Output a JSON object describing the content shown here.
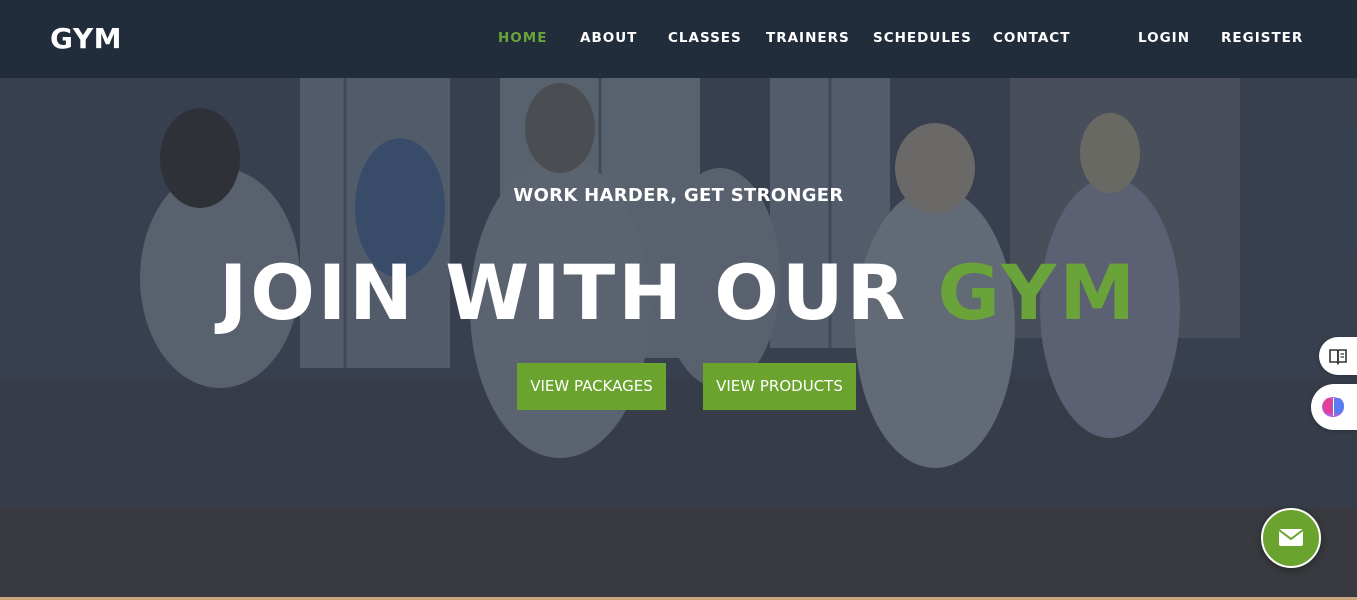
{
  "brand": {
    "logo": "GYM"
  },
  "nav": {
    "items": [
      {
        "label": "HOME",
        "active": true
      },
      {
        "label": "ABOUT"
      },
      {
        "label": "CLASSES"
      },
      {
        "label": "TRAINERS"
      },
      {
        "label": "SCHEDULES"
      },
      {
        "label": "CONTACT"
      }
    ],
    "login": "LOGIN",
    "register": "REGISTER"
  },
  "hero": {
    "subtitle": "WORK HARDER, GET STRONGER",
    "title_main": "JOIN WITH OUR ",
    "title_accent": "GYM",
    "buttons": {
      "packages": "VIEW PACKAGES",
      "products": "VIEW PRODUCTS"
    }
  },
  "widgets": {
    "reader": "book-reader-icon",
    "ai": "brain-icon",
    "mail": "envelope-icon"
  },
  "colors": {
    "accent": "#6aa33a",
    "nav_bg": "#222d3c"
  }
}
